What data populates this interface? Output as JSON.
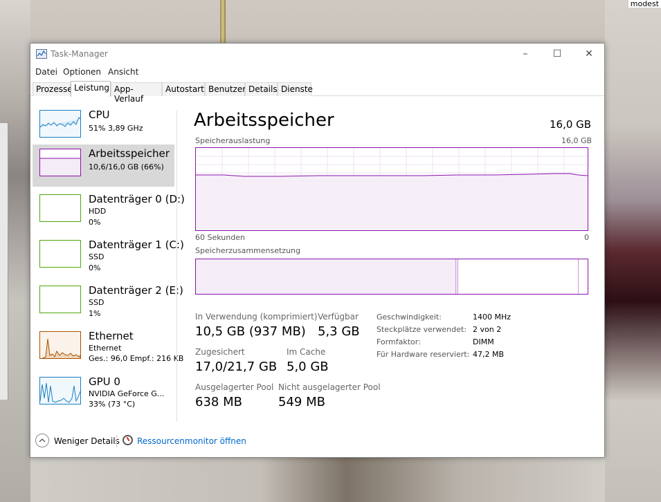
{
  "desktop": {
    "corner_text": "modest"
  },
  "window": {
    "title": "Task-Manager",
    "controls": {
      "minimize": "–",
      "maximize": "☐",
      "close": "✕"
    }
  },
  "menu": [
    "Datei",
    "Optionen",
    "Ansicht"
  ],
  "tabs": [
    "Prozesse",
    "Leistung",
    "App-Verlauf",
    "Autostart",
    "Benutzer",
    "Details",
    "Dienste"
  ],
  "active_tab": "Leistung",
  "sidebar": [
    {
      "name": "CPU",
      "line1": "51% 3,89 GHz",
      "line2": "",
      "color": "#1a7fbf"
    },
    {
      "name": "Arbeitsspeicher",
      "line1": "10,6/16,0 GB (66%)",
      "line2": "",
      "color": "#8b12ae"
    },
    {
      "name": "Datenträger 0 (D:)",
      "line1": "HDD",
      "line2": "0%",
      "color": "#4da60c"
    },
    {
      "name": "Datenträger 1 (C:)",
      "line1": "SSD",
      "line2": "0%",
      "color": "#4da60c"
    },
    {
      "name": "Datenträger 2 (E:)",
      "line1": "SSD",
      "line2": "1%",
      "color": "#4da60c"
    },
    {
      "name": "Ethernet",
      "line1": "Ethernet",
      "line2": "Ges.: 96,0 Empf.: 216 KB",
      "color": "#a74f01"
    },
    {
      "name": "GPU 0",
      "line1": "NVIDIA GeForce G...",
      "line2": "33% (73 °C)",
      "color": "#1a7fbf"
    }
  ],
  "main": {
    "title": "Arbeitsspeicher",
    "total": "16,0 GB",
    "usage_label": "Speicherauslastung",
    "usage_max": "16,0 GB",
    "time_left": "60 Sekunden",
    "time_right": "0",
    "composition_label": "Speicherzusammensetzung",
    "memory_used_fraction": 0.66,
    "stats": {
      "in_use_label": "In Verwendung (komprimiert)",
      "in_use_value": "10,5 GB (937 MB)",
      "available_label": "Verfügbar",
      "available_value": "5,3 GB",
      "committed_label": "Zugesichert",
      "committed_value": "17,0/21,7 GB",
      "cached_label": "Im Cache",
      "cached_value": "5,0 GB",
      "paged_label": "Ausgelagerter Pool",
      "paged_value": "638 MB",
      "nonpaged_label": "Nicht ausgelagerter Pool",
      "nonpaged_value": "549 MB"
    },
    "details": [
      {
        "label": "Geschwindigkeit:",
        "value": "1400 MHz"
      },
      {
        "label": "Steckplätze verwendet:",
        "value": "2 von 2"
      },
      {
        "label": "Formfaktor:",
        "value": "DIMM"
      },
      {
        "label": "Für Hardware reserviert:",
        "value": "47,2 MB"
      }
    ]
  },
  "footer": {
    "less_details": "Weniger Details",
    "resource_monitor": "Ressourcenmonitor öffnen"
  }
}
